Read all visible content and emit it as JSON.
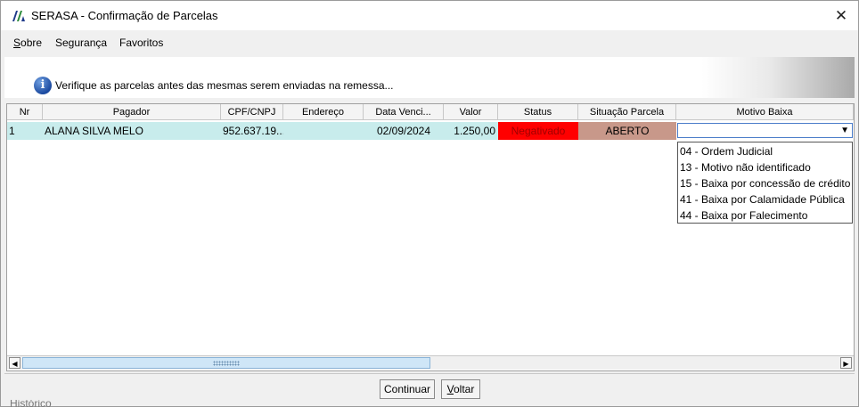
{
  "window": {
    "title": "SERASA - Confirmação de Parcelas",
    "close_glyph": "✕"
  },
  "icons": {
    "app_logo": "serasa-logo-icon",
    "close": "close-icon",
    "info": "info-icon",
    "dropdown_arrow": "chevron-down-icon"
  },
  "menu": {
    "items": [
      {
        "accel": "S",
        "rest": "obre"
      },
      {
        "label": "Segurança"
      },
      {
        "label": "Favoritos"
      }
    ]
  },
  "banner": {
    "info_glyph": "i",
    "message": "Verifique as parcelas antes das mesmas serem enviadas na remessa..."
  },
  "grid": {
    "columns": [
      "Nr",
      "Pagador",
      "CPF/CNPJ",
      "Endereço",
      "Data Venci...",
      "Valor",
      "Status",
      "Situação Parcela",
      "Motivo Baixa"
    ],
    "rows": [
      {
        "nr": "1",
        "pagador": "ALANA SILVA MELO",
        "cpf": "952.637.19...",
        "endereco": "",
        "data_venc": "02/09/2024",
        "valor": "1.250,00",
        "status": "Negativado",
        "situacao": "ABERTO",
        "motivo": ""
      }
    ],
    "motivo_options": [
      "04 - Ordem Judicial",
      "13 - Motivo não identificado",
      "15 - Baixa por concessão de crédito",
      "41 - Baixa por Calamidade Pública",
      "44 - Baixa por Falecimento"
    ],
    "colors": {
      "row_bg": "#c8ecec",
      "status_bg": "#ff0000",
      "situacao_bg": "#c8988a"
    }
  },
  "scrollbar": {
    "left_arrow": "◀",
    "right_arrow": "▶"
  },
  "buttons": {
    "continuar": "Continuar",
    "voltar_accel": "V",
    "voltar_rest": "oltar"
  },
  "footer": {
    "cutoff_label": "Histórico"
  }
}
